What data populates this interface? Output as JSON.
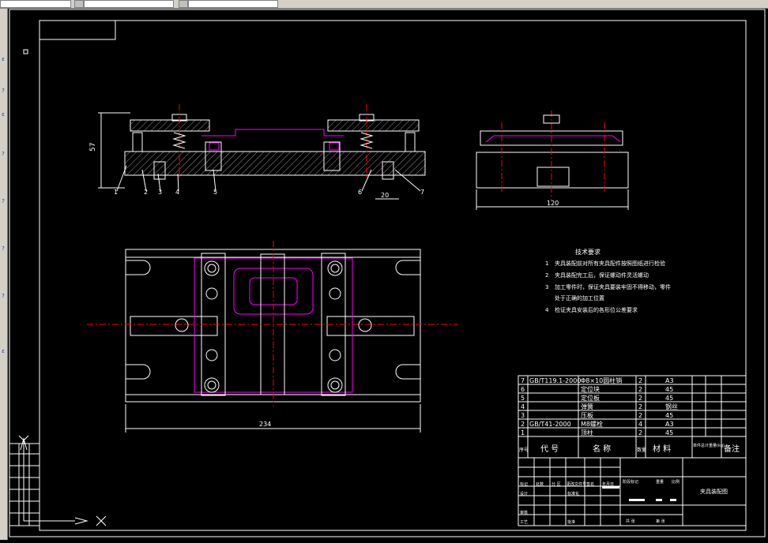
{
  "app": {
    "toolbar_colors": {
      "bar": "#d4d0c8",
      "field": "#ffffff"
    },
    "drawing_colors": {
      "outline": "#ffffff",
      "hatch": "#ffffff",
      "fixture": "#ff00ff",
      "centerline": "#ff0000"
    }
  },
  "dimensions": {
    "height_57": "57",
    "width_234": "234",
    "width_120": "120",
    "slot_20": "20"
  },
  "callouts": [
    "1",
    "2",
    "3",
    "4",
    "5",
    "6",
    "7"
  ],
  "tech_requirements": {
    "title": "技术要求",
    "items": [
      {
        "num": "1",
        "text": "夹具装配前对所有夹具配件按照图纸进行检验"
      },
      {
        "num": "2",
        "text": "夹具装配完工后，保证螺动件灵活螺动"
      },
      {
        "num": "3",
        "text": "加工零件时，保证夹具要装牢固不得移动，零件"
      },
      {
        "num": "",
        "text": "处于正确的加工位置"
      },
      {
        "num": "4",
        "text": "检证夹具安装后的各形位公差要求"
      }
    ]
  },
  "bom": {
    "rows": [
      {
        "num": "7",
        "code": "GB/T119.1-2000",
        "name": "Φ8×10圆柱销",
        "qty": "2",
        "material": "A3"
      },
      {
        "num": "6",
        "code": "",
        "name": "定位块",
        "qty": "2",
        "material": "45"
      },
      {
        "num": "5",
        "code": "",
        "name": "定位板",
        "qty": "2",
        "material": "45"
      },
      {
        "num": "4",
        "code": "",
        "name": "弹簧",
        "qty": "2",
        "material": "钢丝"
      },
      {
        "num": "3",
        "code": "",
        "name": "压板",
        "qty": "2",
        "material": "45"
      },
      {
        "num": "2",
        "code": "GB/T41-2000",
        "name": "M8螺栓",
        "qty": "4",
        "material": "A3"
      },
      {
        "num": "1",
        "code": "",
        "name": "顶柱",
        "qty": "2",
        "material": "45"
      }
    ],
    "header": {
      "num": "序号",
      "code": "代 号",
      "name": "名 称",
      "qty": "数量",
      "material": "材 料",
      "weight": "单件总计重量(kg)",
      "remark": "备注"
    }
  },
  "title_block": {
    "drawing_title": "夹具装配图",
    "labels": [
      "标记",
      "处数",
      "分 区",
      "更改文件号",
      "签名",
      "年月日",
      "设计",
      "标准化",
      "审核",
      "工艺",
      "批准",
      "阶段标记",
      "重量",
      "比例",
      "共 张",
      "第 张"
    ]
  }
}
